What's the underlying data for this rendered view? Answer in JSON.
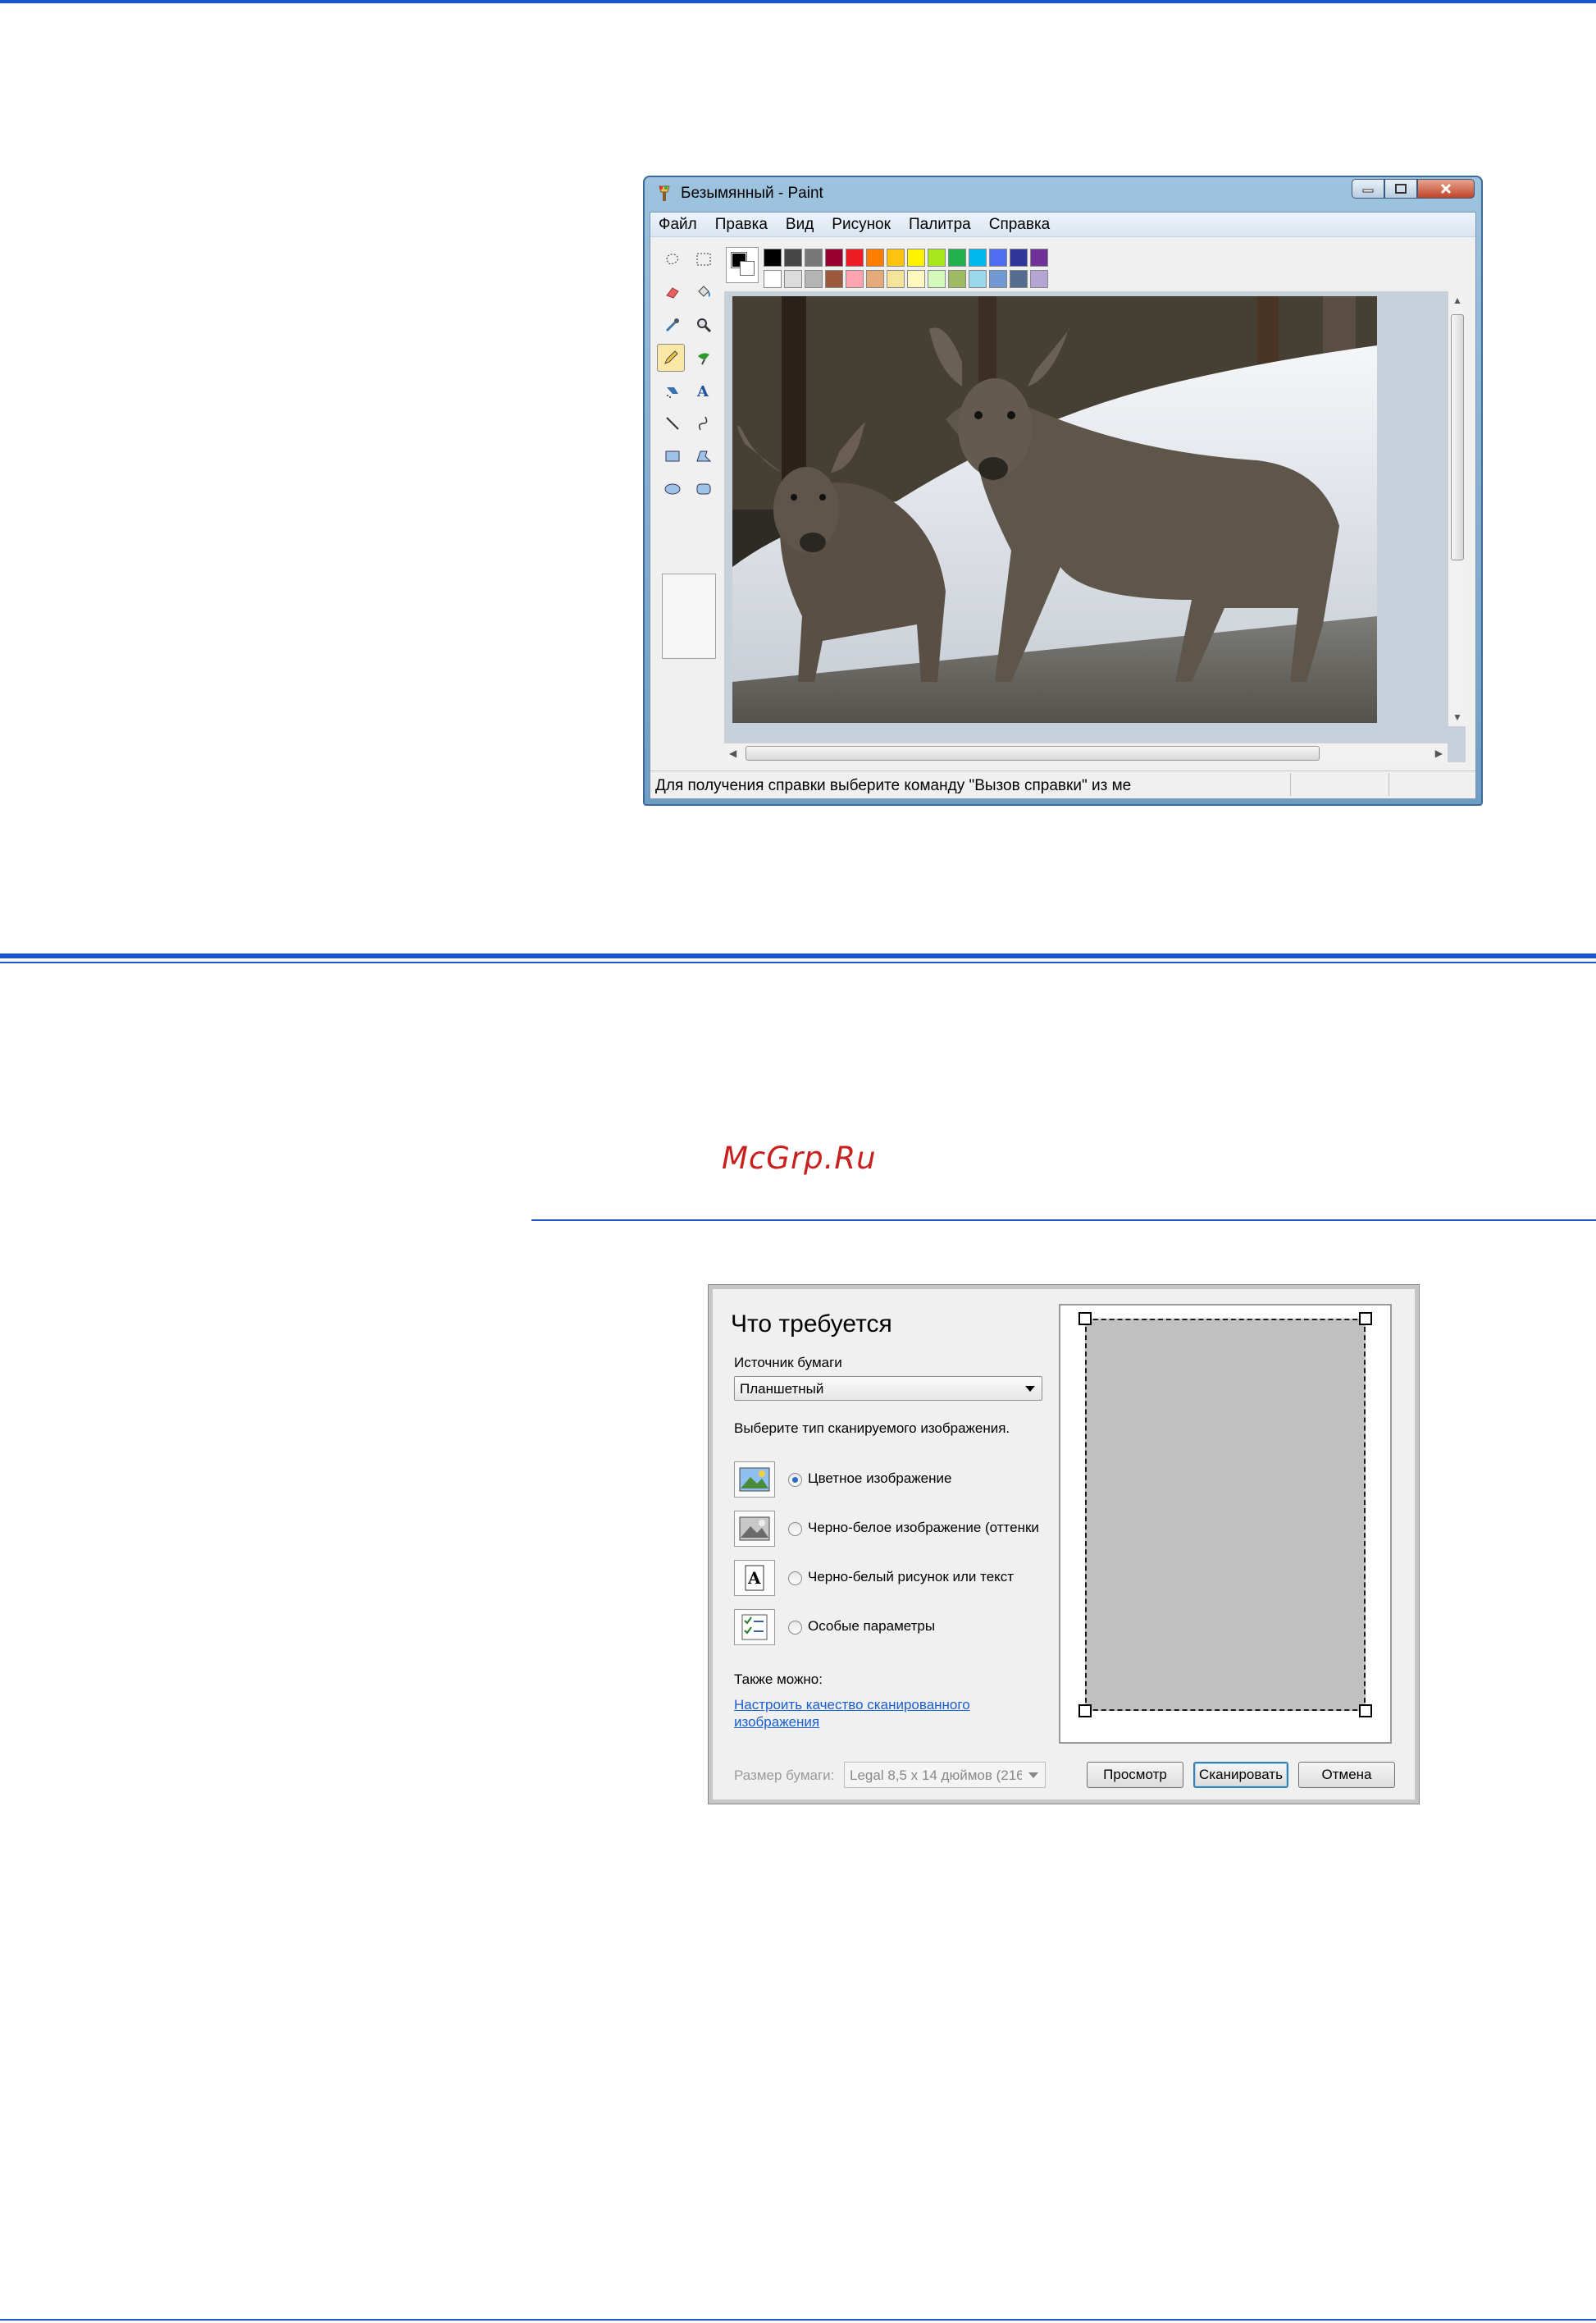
{
  "watermark": "McGrp.Ru",
  "paint": {
    "title": "Безымянный - Paint",
    "menu": [
      "Файл",
      "Правка",
      "Вид",
      "Рисунок",
      "Палитра",
      "Справка"
    ],
    "status": "Для получения справки выберите команду \"Вызов справки\" из ме",
    "palette_top": [
      "#000000",
      "#464646",
      "#787878",
      "#990030",
      "#ed1c24",
      "#ff7e00",
      "#ffc20e",
      "#fff200",
      "#a8e61d",
      "#22b14c",
      "#00b7ef",
      "#4d6df3",
      "#2f3699",
      "#6f3198"
    ],
    "palette_bottom": [
      "#ffffff",
      "#dcdcdc",
      "#b4b4b4",
      "#9c5a3c",
      "#ffa3b1",
      "#e5aa7a",
      "#f5e49c",
      "#fff9bd",
      "#d3f9bc",
      "#9dbb61",
      "#99d9ea",
      "#709ad1",
      "#546d8e",
      "#b5a5d5"
    ]
  },
  "scan": {
    "title": "Что требуется",
    "source_label": "Источник бумаги",
    "source_value": "Планшетный",
    "type_label": "Выберите тип сканируемого изображения.",
    "options": [
      {
        "label": "Цветное изображение",
        "selected": true
      },
      {
        "label": "Черно-белое изображение (оттенки",
        "selected": false
      },
      {
        "label": "Черно-белый рисунок или текст",
        "selected": false
      },
      {
        "label": "Особые параметры",
        "selected": false
      }
    ],
    "also_label": "Также можно:",
    "link": "Настроить качество сканированного изображения",
    "paper_size_label": "Размер бумаги:",
    "paper_size_value": "Legal 8,5 x 14 дюймов (216",
    "buttons": {
      "preview": "Просмотр",
      "scan": "Сканировать",
      "cancel": "Отмена"
    }
  }
}
